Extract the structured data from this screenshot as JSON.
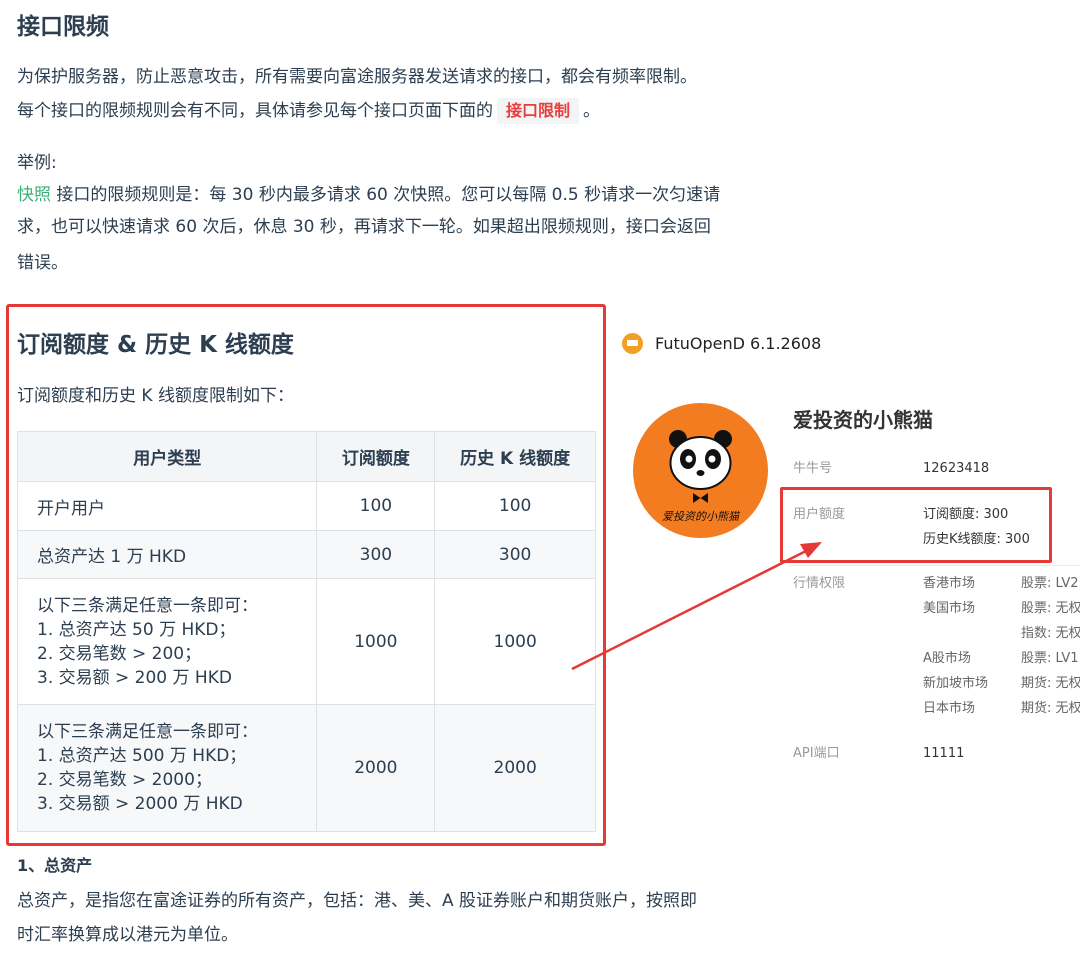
{
  "doc": {
    "title": "接口限频",
    "para1_line1": "为保护服务器，防止恶意攻击，所有需要向富途服务器发送请求的接口，都会有频率限制。",
    "para1_line2_pre": "每个接口的限频规则会有不同，具体请参见每个接口页面下面的",
    "para1_tag": "接口限制",
    "para1_line2_post": "。",
    "example_label": "举例:",
    "example_link": "快照",
    "example_line1": " 接口的限频规则是：每 30 秒内最多请求 60 次快照。您可以每隔 0.5 秒请求一次匀速请",
    "example_line2": "求，也可以快速请求 60 次后，休息 30 秒，再请求下一轮。如果超出限频规则，接口会返回",
    "example_line3": "错误。"
  },
  "quota": {
    "title": "订阅额度 & 历史 K 线额度",
    "intro": "订阅额度和历史 K 线额度限制如下：",
    "headers": [
      "用户类型",
      "订阅额度",
      "历史 K 线额度"
    ],
    "rows": [
      {
        "type": "开户用户",
        "sub": "100",
        "kline": "100"
      },
      {
        "type": "总资产达 1 万 HKD",
        "sub": "300",
        "kline": "300"
      },
      {
        "title": "以下三条满足任意一条即可：",
        "lines": [
          "1. 总资产达 50 万 HKD；",
          "2. 交易笔数 > 200；",
          "3. 交易额 > 200 万 HKD"
        ],
        "sub": "1000",
        "kline": "1000"
      },
      {
        "title": "以下三条满足任意一条即可：",
        "lines": [
          "1. 总资产达 500 万 HKD；",
          "2. 交易笔数 > 2000；",
          "3. 交易额 > 2000 万 HKD"
        ],
        "sub": "2000",
        "kline": "2000"
      }
    ]
  },
  "assets": {
    "heading": "1、总资产",
    "line1": "总资产，是指您在富途证券的所有资产，包括：港、美、A 股证券账户和期货账户，按照即",
    "line2": "时汇率换算成以港元为单位。"
  },
  "app": {
    "window_title": "FutuOpenD 6.1.2608",
    "avatar_caption": "爱投资的小熊猫",
    "username": "爱投资的小熊猫",
    "niuniu_label": "牛牛号",
    "niuniu_value": "12623418",
    "quota_label": "用户额度",
    "quota_sub": "订阅额度: 300",
    "quota_kline": "历史K线额度: 300",
    "market_label": "行情权限",
    "markets": [
      {
        "name": "香港市场",
        "perm": "股票: LV2"
      },
      {
        "name": "美国市场",
        "perm": "股票: 无权限"
      },
      {
        "name": "",
        "perm": "指数: 无权限"
      },
      {
        "name": "A股市场",
        "perm": "股票: LV1"
      },
      {
        "name": "新加坡市场",
        "perm": "期货: 无权限"
      },
      {
        "name": "日本市场",
        "perm": "期货: 无权限"
      }
    ],
    "api_label": "API端口",
    "api_value": "11111"
  },
  "colors": {
    "highlight_red": "#e53935",
    "link_green": "#3eaf7c",
    "text": "#2c3e50",
    "avatar_orange": "#f47c20"
  }
}
